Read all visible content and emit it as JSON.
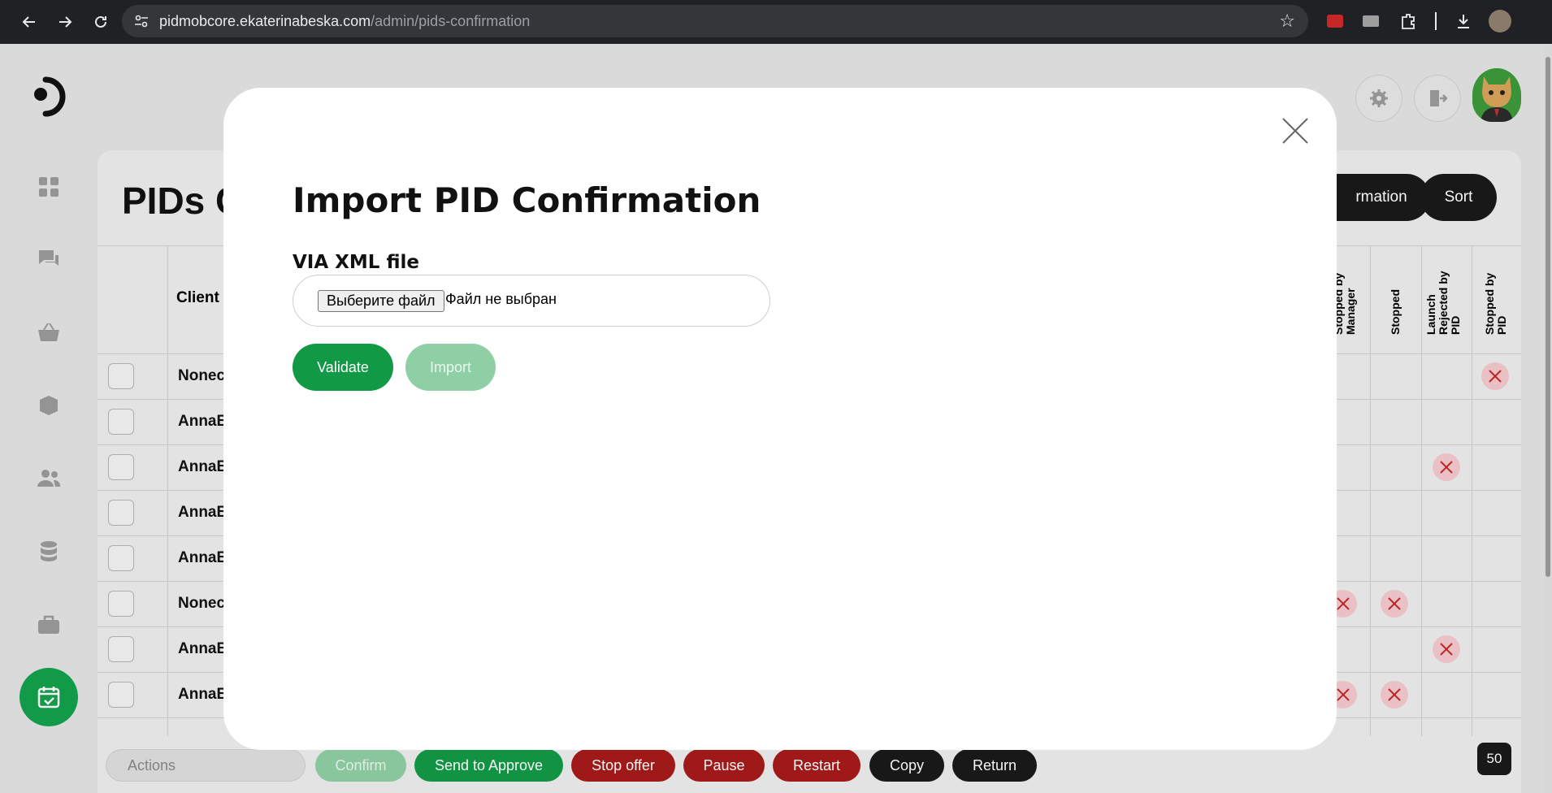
{
  "browser": {
    "url_host": "pidmobcore.ekaterinabeska.com",
    "url_path": "/admin/pids-confirmation",
    "icons": [
      "back-icon",
      "forward-icon",
      "reload-icon",
      "site-settings-icon",
      "bookmark-star-icon",
      "extension-icon",
      "download-icon"
    ]
  },
  "page": {
    "title": "PIDs C",
    "header_buttons": {
      "confirmation_label": "rmation",
      "sort_label": "Sort"
    }
  },
  "sidebar": {
    "icons": [
      "dashboard-icon",
      "chat-icon",
      "basket-icon",
      "box-icon",
      "users-icon",
      "database-icon",
      "briefcase-icon",
      "calendar-check-icon"
    ]
  },
  "table": {
    "headers": {
      "client": "Client",
      "stopped_by_manager": "Stopped by Manager",
      "stopped": "Stopped",
      "launch_rejected": "Launch Rejected by PID",
      "stopped_by_pid": "Stopped by PID"
    },
    "rows": [
      {
        "client": "Nonec"
      },
      {
        "client": "AnnaB"
      },
      {
        "client": "AnnaB"
      },
      {
        "client": "AnnaB"
      },
      {
        "client": "AnnaB"
      },
      {
        "client": "Nonec"
      },
      {
        "client": "AnnaB"
      },
      {
        "client": "AnnaB"
      }
    ]
  },
  "footer": {
    "actions_placeholder": "Actions",
    "buttons": {
      "confirm": "Confirm",
      "send_to_approve": "Send to Approve",
      "stop_offer": "Stop offer",
      "pause": "Pause",
      "restart": "Restart",
      "copy": "Copy",
      "return": "Return"
    },
    "page_size": "50"
  },
  "modal": {
    "title": "Import PID Confirmation",
    "via_label": "VIA XML file",
    "file_button": "Выберите файл",
    "file_status": "Файл не выбран",
    "validate_label": "Validate",
    "import_label": "Import"
  },
  "colors": {
    "green": "#129946",
    "green_disabled": "#8fcfa5",
    "red": "#a61b1b",
    "dark": "#1a1a1a"
  }
}
